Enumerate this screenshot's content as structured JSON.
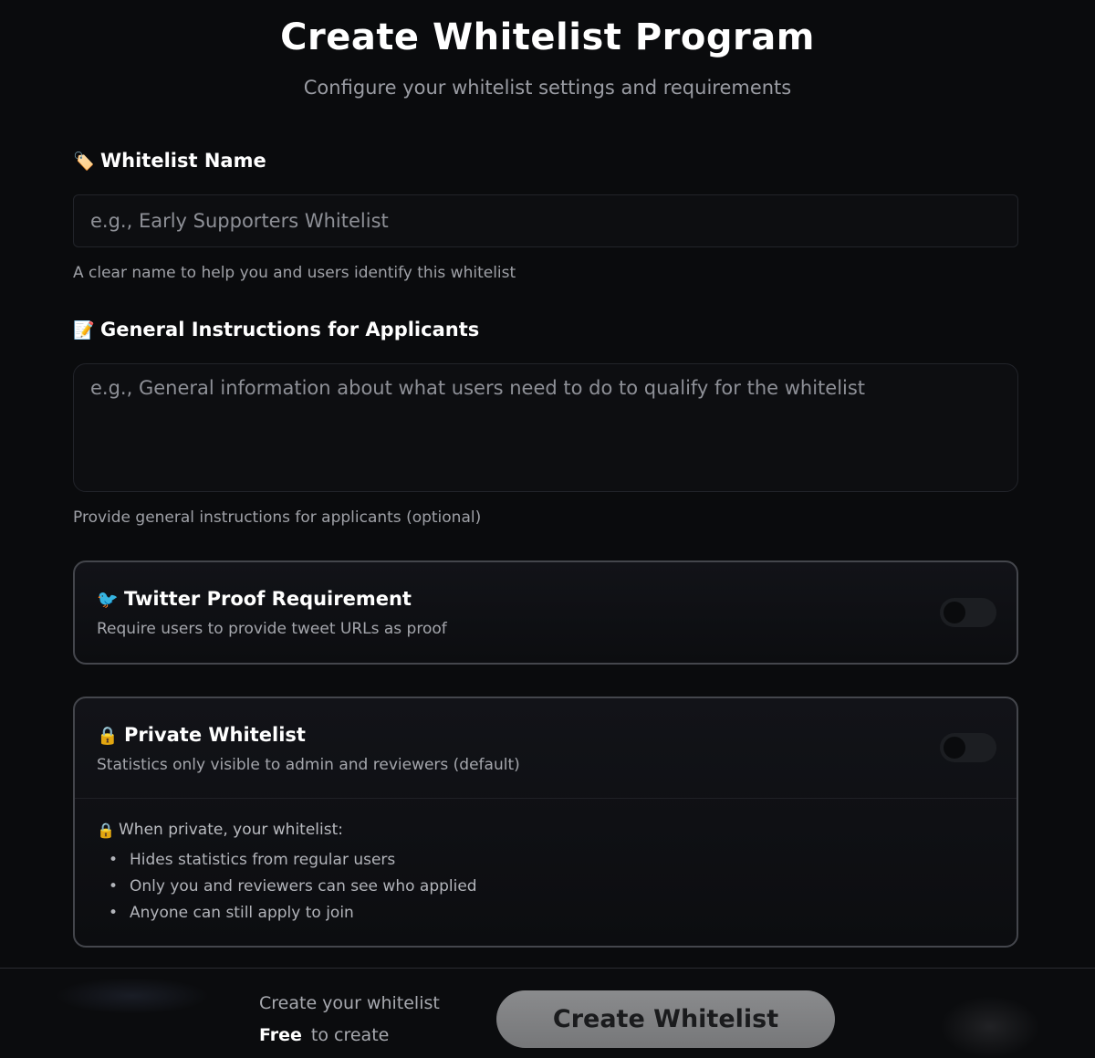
{
  "header": {
    "title": "Create Whitelist Program",
    "subtitle": "Configure your whitelist settings and requirements"
  },
  "name_field": {
    "icon": "🏷️",
    "label": "Whitelist Name",
    "placeholder": "e.g., Early Supporters Whitelist",
    "value": "",
    "help": "A clear name to help you and users identify this whitelist"
  },
  "instructions_field": {
    "icon": "📝",
    "label": "General Instructions for Applicants",
    "placeholder": "e.g., General information about what users need to do to qualify for the whitelist",
    "value": "",
    "help": "Provide general instructions for applicants (optional)"
  },
  "twitter_card": {
    "icon": "🐦",
    "title": "Twitter Proof Requirement",
    "description": "Require users to provide tweet URLs as proof",
    "enabled": false
  },
  "private_card": {
    "icon": "🔒",
    "title": "Private Whitelist",
    "description": "Statistics only visible to admin and reviewers (default)",
    "enabled": false,
    "info_icon": "🔒",
    "info_title": "When private, your whitelist:",
    "info_items": [
      "Hides statistics from regular users",
      "Only you and reviewers can see who applied",
      "Anyone can still apply to join"
    ]
  },
  "footer": {
    "line1": "Create your whitelist",
    "free_label": "Free",
    "free_suffix": "to create",
    "button_label": "Create Whitelist"
  },
  "colors": {
    "background": "#0a0b0d",
    "card_border": "#44464c",
    "button_bg": "#808183",
    "muted_text": "#9a9ca3"
  }
}
